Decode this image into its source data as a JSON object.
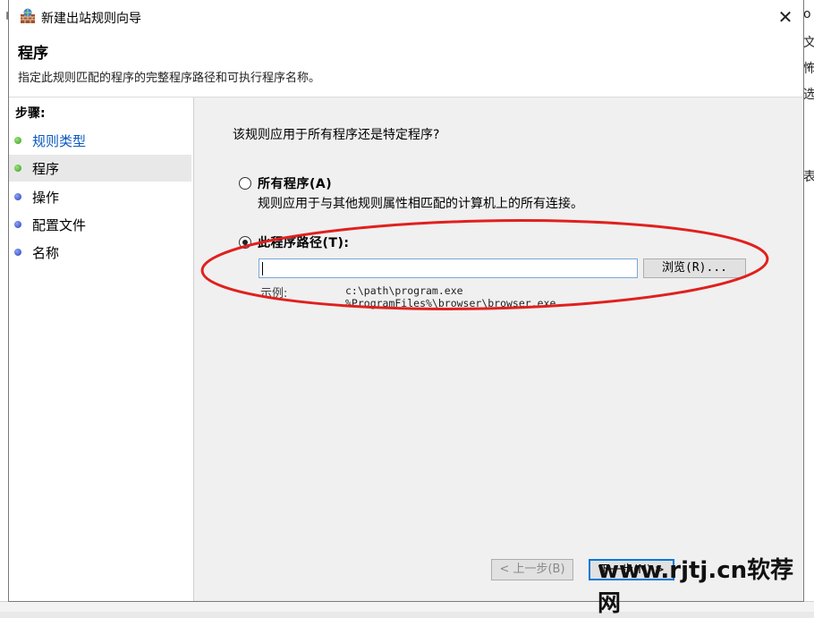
{
  "background": {
    "left_char": "刂",
    "right_chars": [
      "o",
      "文",
      "怖",
      "选",
      "表"
    ]
  },
  "dialog": {
    "title": "新建出站规则向导",
    "close_glyph": "✕"
  },
  "header": {
    "title": "程序",
    "description": "指定此规则匹配的程序的完整程序路径和可执行程序名称。"
  },
  "steps": {
    "heading": "步骤:",
    "items": [
      {
        "label": "规则类型",
        "state": "done"
      },
      {
        "label": "程序",
        "state": "current"
      },
      {
        "label": "操作",
        "state": "pending"
      },
      {
        "label": "配置文件",
        "state": "pending"
      },
      {
        "label": "名称",
        "state": "pending"
      }
    ]
  },
  "content": {
    "question": "该规则应用于所有程序还是特定程序?",
    "option_all": {
      "label": "所有程序(A)",
      "description": "规则应用于与其他规则属性相匹配的计算机上的所有连接。",
      "selected": false
    },
    "option_path": {
      "label": "此程序路径(T):",
      "selected": true
    },
    "path_input_value": "",
    "browse_label": "浏览(R)...",
    "example_label": "示例:",
    "example_lines": [
      "c:\\path\\program.exe",
      "%ProgramFiles%\\browser\\browser.exe"
    ]
  },
  "buttons": {
    "back": "< 上一步(B)",
    "next": "下一步(N) >"
  },
  "watermark": "www.rjtj.cn软荐网",
  "colors": {
    "annotation": "#e0201e",
    "link": "#0a58c0",
    "step_done": "#3a9a20",
    "step_pending": "#2a3fb0",
    "focus": "#0078d7"
  }
}
